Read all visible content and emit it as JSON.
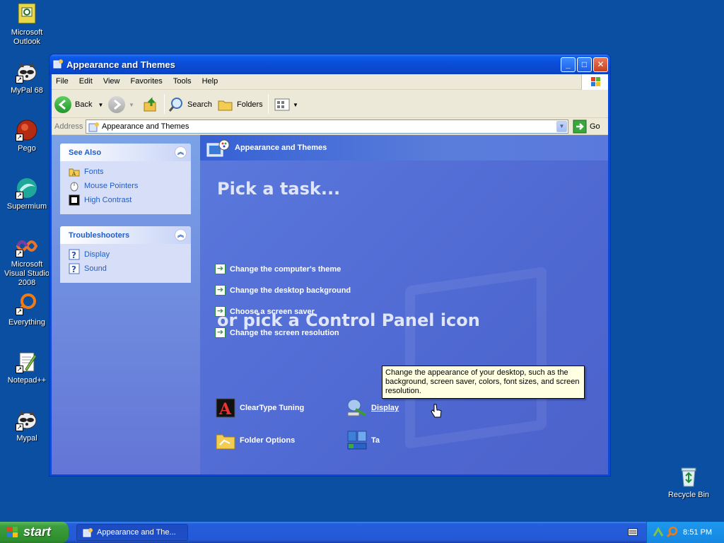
{
  "desktop": {
    "icons": [
      {
        "label": "Microsoft Outlook",
        "icon": "outlook-icon"
      },
      {
        "label": "MyPal 68",
        "icon": "mypal-icon"
      },
      {
        "label": "Pego",
        "icon": "pego-icon"
      },
      {
        "label": "Supermium",
        "icon": "supermium-icon"
      },
      {
        "label": "Microsoft Visual Studio 2008",
        "icon": "visual-studio-icon"
      },
      {
        "label": "Everything",
        "icon": "everything-icon"
      },
      {
        "label": "Notepad++",
        "icon": "notepad-plus-plus-icon"
      },
      {
        "label": "Mypal",
        "icon": "mypal-icon"
      },
      {
        "label": "Recycle Bin",
        "icon": "recycle-bin-icon"
      }
    ]
  },
  "window": {
    "title": "Appearance and Themes",
    "menu": [
      "File",
      "Edit",
      "View",
      "Favorites",
      "Tools",
      "Help"
    ],
    "toolbar": {
      "back": "Back",
      "search": "Search",
      "folders": "Folders"
    },
    "address": {
      "label": "Address",
      "value": "Appearance and Themes",
      "go": "Go"
    }
  },
  "left_pane": {
    "see_also": {
      "title": "See Also",
      "items": [
        "Fonts",
        "Mouse Pointers",
        "High Contrast"
      ]
    },
    "troubleshooters": {
      "title": "Troubleshooters",
      "items": [
        "Display",
        "Sound"
      ]
    }
  },
  "right_pane": {
    "header": "Appearance and Themes",
    "pick_task": "Pick a task...",
    "tasks": [
      "Change the computer's theme",
      "Change the desktop background",
      "Choose a screen saver",
      "Change the screen resolution"
    ],
    "pick_icon": "or pick a Control Panel icon",
    "icons": [
      "ClearType Tuning",
      "Display",
      "Folder Options",
      "Ta"
    ]
  },
  "tooltip": "Change the appearance of your desktop, such as the background, screen saver, colors, font sizes, and screen resolution.",
  "taskbar": {
    "start": "start",
    "task_button": "Appearance and The...",
    "clock": "8:51 PM"
  },
  "colors": {
    "desktop": "#0b4fa3",
    "titlebar": "#0a4cd6",
    "task_link": "#ffffff",
    "pane_link": "#215dc6"
  }
}
